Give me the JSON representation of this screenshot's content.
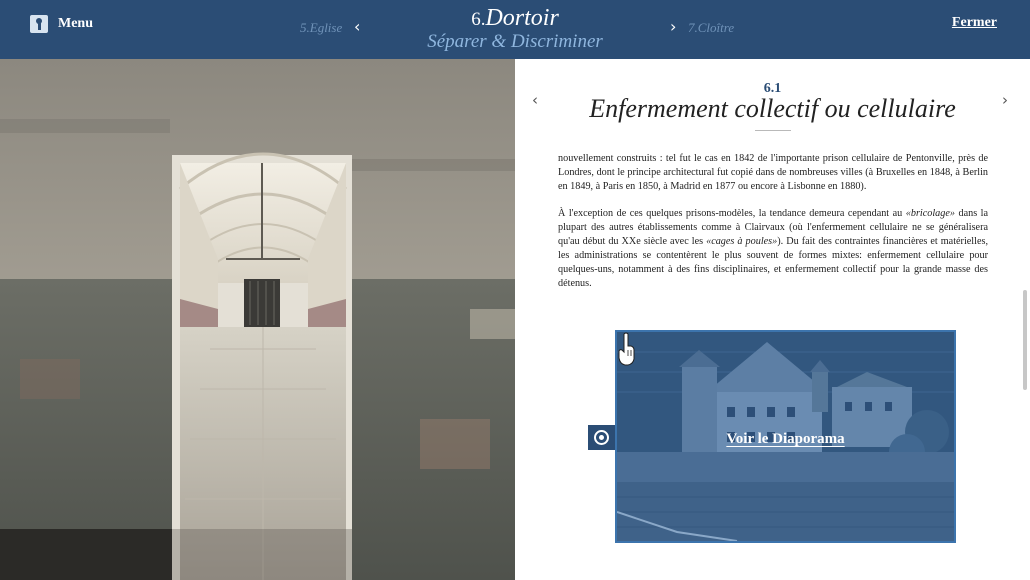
{
  "header": {
    "menu_label": "Menu",
    "prev_chapter": "5.Eglise",
    "next_chapter": "7.Cloître",
    "chapter_number": "6.",
    "chapter_title": "Dortoir",
    "chapter_subtitle": "Séparer & Discriminer",
    "close_label": "Fermer",
    "prev_glyph": "‹",
    "next_glyph": "›"
  },
  "section": {
    "number": "6.1",
    "title": "Enfermement collectif ou cellulaire",
    "prev_glyph": "‹",
    "next_glyph": "›"
  },
  "body": {
    "paragraph_1": "nouvellement construits : tel fut le cas en 1842 de l'importante prison cellulaire de Pentonville, près de Londres, dont le principe architectural fut copié dans de nombreuses villes (à Bruxelles en 1848, à Berlin en 1849, à Paris en 1850, à Madrid en 1877 ou encore à Lisbonne en 1880).",
    "paragraph_2a": "À l'exception de ces quelques prisons-modèles, la tendance demeura cependant au ",
    "paragraph_2b": "«bricolage»",
    "paragraph_2c": " dans la plupart des autres établissements comme à Clairvaux (où l'enfermement cellulaire ne se généralisera qu'au début du XXe siècle avec les ",
    "paragraph_2d": "«cages à poules»",
    "paragraph_2e": "). Du fait des contraintes financières et matérielles, les administrations se contentèrent le plus souvent de formes mixtes: enfermement cellulaire pour quelques-uns, notamment à des fins disciplinaires, et enfermement collectif pour la grande masse des détenus."
  },
  "slideshow": {
    "label": "Voir le Diaporama",
    "camera_icon": "camera-icon",
    "hand_icon": "pointing-hand-icon"
  },
  "colors": {
    "header_bg": "#2b4d75",
    "subtitle": "#8fb6de",
    "muted_nav": "#6f92b8",
    "slideshow_border": "#3c74ad"
  }
}
